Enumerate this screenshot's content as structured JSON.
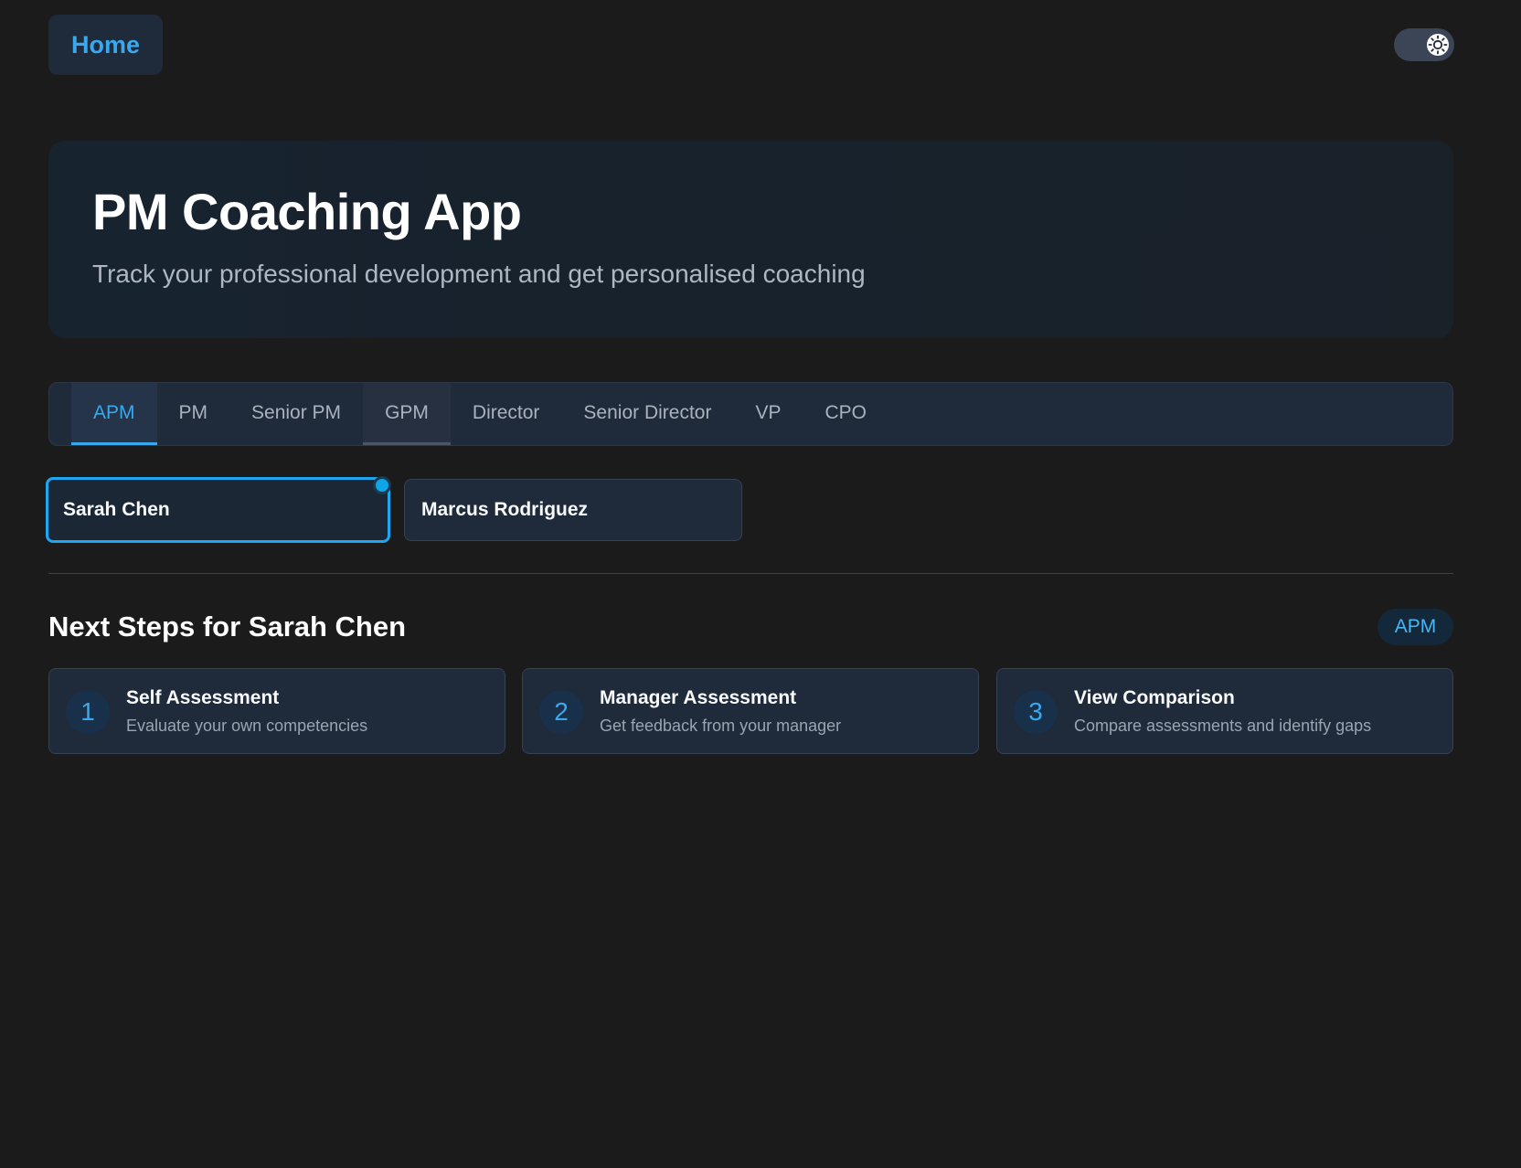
{
  "header": {
    "home_label": "Home",
    "theme_toggle_icon": "sun-icon"
  },
  "hero": {
    "title": "PM Coaching App",
    "subtitle": "Track your professional development and get personalised coaching"
  },
  "tabs": [
    {
      "label": "APM",
      "state": "active"
    },
    {
      "label": "PM",
      "state": "default"
    },
    {
      "label": "Senior PM",
      "state": "default"
    },
    {
      "label": "GPM",
      "state": "hover"
    },
    {
      "label": "Director",
      "state": "default"
    },
    {
      "label": "Senior Director",
      "state": "default"
    },
    {
      "label": "VP",
      "state": "default"
    },
    {
      "label": "CPO",
      "state": "default"
    }
  ],
  "people": [
    {
      "name": "Sarah Chen",
      "selected": true
    },
    {
      "name": "Marcus Rodriguez",
      "selected": false
    }
  ],
  "next_steps": {
    "title": "Next Steps for Sarah Chen",
    "level_badge": "APM",
    "steps": [
      {
        "number": "1",
        "title": "Self Assessment",
        "description": "Evaluate your own competencies"
      },
      {
        "number": "2",
        "title": "Manager Assessment",
        "description": "Get feedback from your manager"
      },
      {
        "number": "3",
        "title": "View Comparison",
        "description": "Compare assessments and identify gaps"
      }
    ]
  },
  "colors": {
    "background": "#1b1b1b",
    "accent": "#38a9f0",
    "card": "#1f2a3a"
  }
}
